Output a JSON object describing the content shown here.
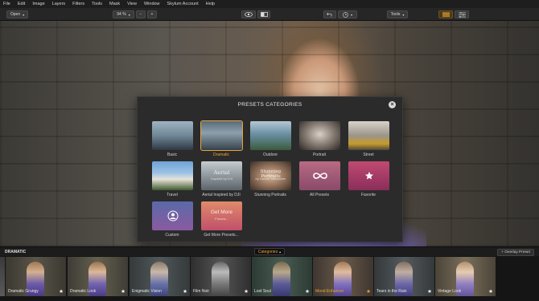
{
  "menu": [
    "File",
    "Edit",
    "Image",
    "Layers",
    "Filters",
    "Tools",
    "Mask",
    "View",
    "Window",
    "Skylum Account",
    "Help"
  ],
  "toolbar": {
    "open_label": "Open",
    "zoom_value": "94 %",
    "zoom_out": "−",
    "zoom_in": "+",
    "tools_label": "Tools"
  },
  "modal": {
    "title": "PRESETS CATEGORIES",
    "categories": [
      {
        "label": "Basic"
      },
      {
        "label": "Dramatic",
        "selected": true
      },
      {
        "label": "Outdoor"
      },
      {
        "label": "Portrait"
      },
      {
        "label": "Street"
      },
      {
        "label": "Travel"
      },
      {
        "label": "Aerial Inspired by DJI",
        "overlay_title": "Aerial",
        "overlay_sub": "Inspired by DJI"
      },
      {
        "label": "Stunning Portraits",
        "overlay_title": "Stunning Portraits",
        "overlay_sub": "by Lauren Vandaveer"
      },
      {
        "label": "All Presets",
        "icon": "infinity-icon"
      },
      {
        "label": "Favorite",
        "icon": "star-icon"
      },
      {
        "label": "Custom",
        "icon": "user-icon"
      },
      {
        "label": "Get More Presets...",
        "overlay_title": "Get More",
        "overlay_sub": "Presets..."
      }
    ]
  },
  "strip": {
    "title": "DRAMATIC",
    "categories_label": "Categories",
    "overlay_preset_label": "+ Overlay Preset",
    "presets": [
      {
        "label": "Dramatic Grungy",
        "active": false
      },
      {
        "label": "Dramatic Look",
        "active": false
      },
      {
        "label": "Enigmatic Vision",
        "active": false
      },
      {
        "label": "Film Noir",
        "active": false
      },
      {
        "label": "Lost Soul",
        "active": false
      },
      {
        "label": "Mood Enhancer",
        "active": true
      },
      {
        "label": "Tears in the Rain",
        "active": false
      },
      {
        "label": "Vintage Look",
        "active": false
      }
    ]
  },
  "colors": {
    "accent": "#e8a33a",
    "modal_bg": "#2b2b2b",
    "app_bg": "#141414"
  }
}
